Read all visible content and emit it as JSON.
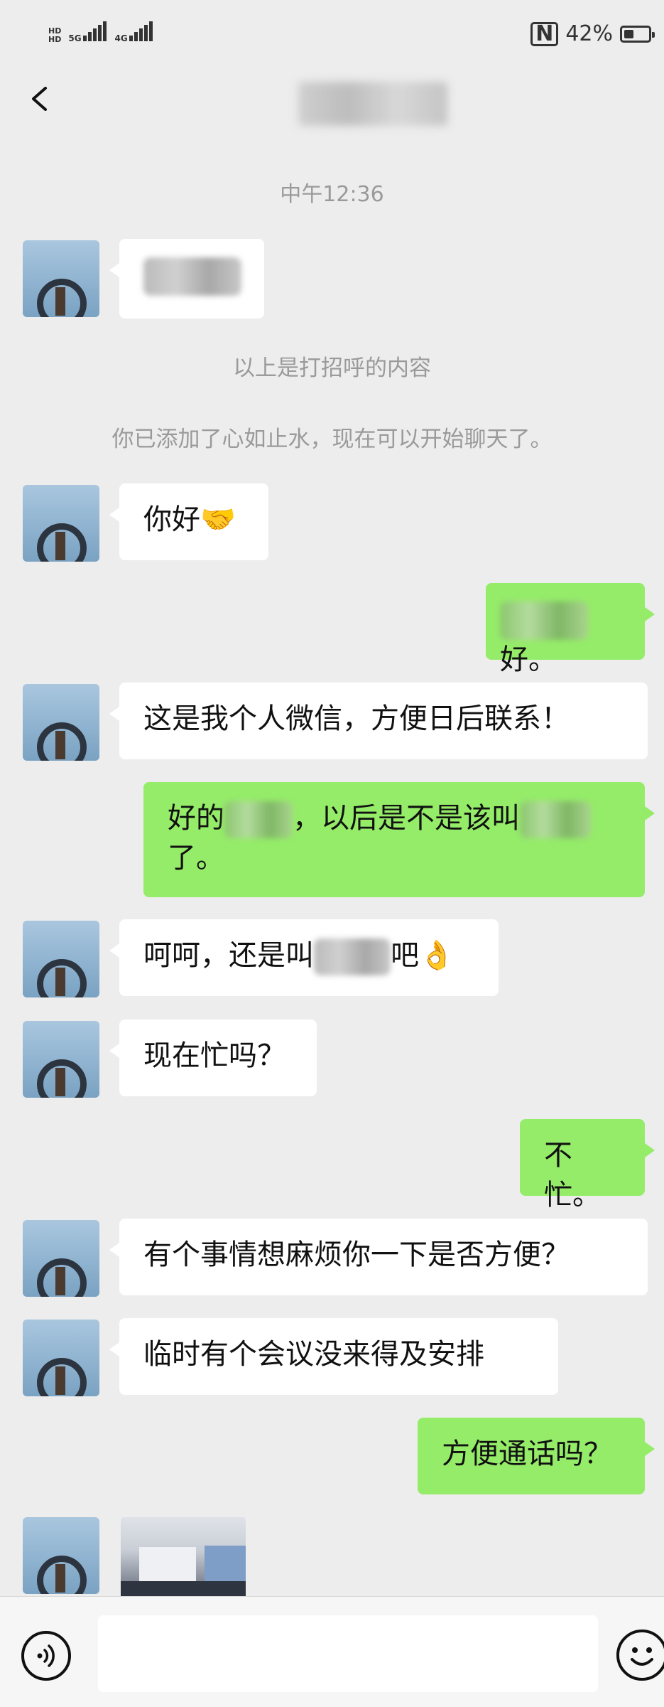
{
  "status_bar": {
    "left_tags": [
      "HD",
      "HD",
      "5G",
      "4G"
    ],
    "battery_text": "42%",
    "battery_level": 0.42,
    "nfc_icon": "nfc-icon"
  },
  "header": {
    "back_icon": "chevron-left-icon"
  },
  "system": {
    "timestamp": "中午12:36",
    "greeting_note": "以上是打招呼的内容",
    "added_note": "你已添加了心如止水，现在可以开始聊天了。"
  },
  "messages": [
    {
      "dir": "in",
      "text": "你好",
      "emoji": "🤝"
    },
    {
      "dir": "out",
      "text": "好。"
    },
    {
      "dir": "in",
      "text": "这是我个人微信，方便日后联系！"
    },
    {
      "dir": "out",
      "text_a": "好的",
      "text_b": "，以后是不是该叫",
      "text_c": "了。"
    },
    {
      "dir": "in",
      "text_a": "呵呵，还是叫",
      "text_b": "吧",
      "emoji": "👌"
    },
    {
      "dir": "in",
      "text": "现在忙吗？"
    },
    {
      "dir": "out",
      "text": "不忙。"
    },
    {
      "dir": "in",
      "text": "有个事情想麻烦你一下是否方便？"
    },
    {
      "dir": "in",
      "text": "临时有个会议没来得及安排"
    },
    {
      "dir": "out",
      "text": "方便通话吗？"
    }
  ],
  "input_bar": {
    "voice_icon": "voice-icon",
    "emoji_icon": "emoji-icon",
    "input_value": ""
  },
  "colors": {
    "background": "#ededed",
    "incoming_bubble": "#ffffff",
    "outgoing_bubble": "#95ec69",
    "system_text": "#9a9a9a"
  }
}
